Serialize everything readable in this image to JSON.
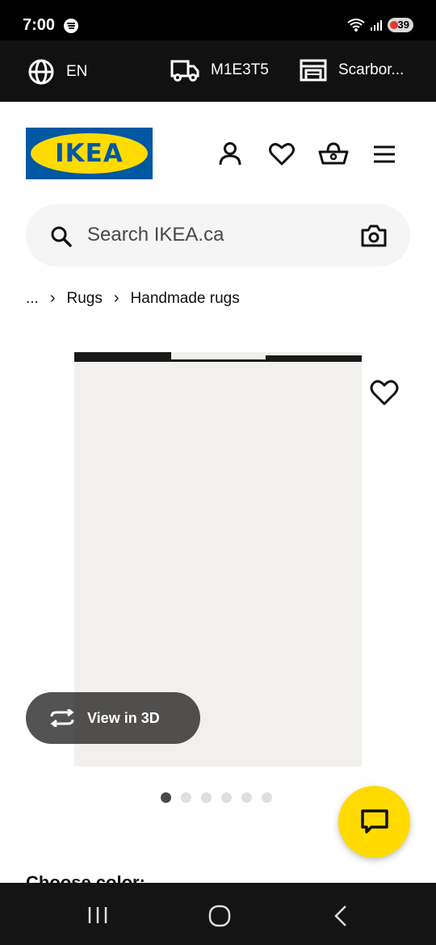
{
  "status_bar": {
    "time": "7:00",
    "battery": "39"
  },
  "utility_bar": {
    "language": "EN",
    "postal_code": "M1E3T5",
    "store": "Scarbor..."
  },
  "header": {
    "logo_text": "IKEA",
    "icons": [
      "account-icon",
      "heart-icon",
      "basket-icon",
      "menu-icon"
    ]
  },
  "search": {
    "placeholder": "Search IKEA.ca"
  },
  "breadcrumb": {
    "more": "...",
    "items": [
      "Rugs",
      "Handmade rugs"
    ]
  },
  "product": {
    "image_desc_icon": "striped-rug-image",
    "view_3d_label": "View in 3D",
    "carousel": {
      "count": 6,
      "active": 0
    }
  },
  "section": {
    "choose_color_label": "Choose color:"
  },
  "colors": {
    "brand_blue": "#0058a3",
    "brand_yellow": "#ffdb00"
  }
}
